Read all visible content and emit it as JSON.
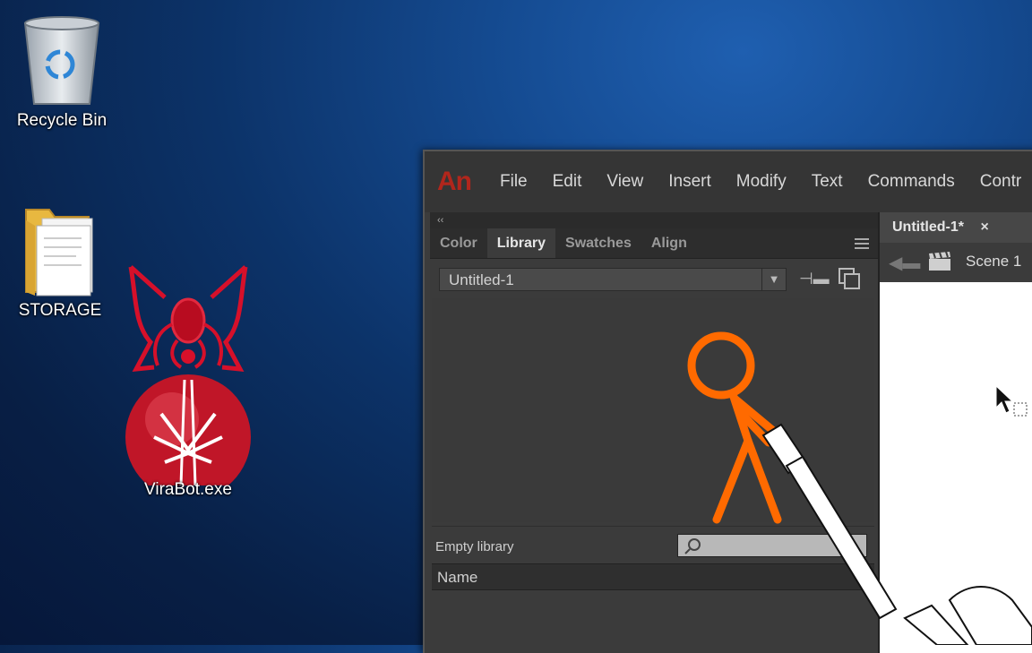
{
  "desktop": {
    "icons": [
      {
        "label": "Recycle Bin",
        "icon": "recycle-bin-icon"
      },
      {
        "label": "STORAGE",
        "icon": "folder-icon"
      },
      {
        "label": "ViraBot.exe",
        "icon": "virabot-spider-icon"
      }
    ]
  },
  "animate": {
    "logo": "An",
    "menu": [
      "File",
      "Edit",
      "View",
      "Insert",
      "Modify",
      "Text",
      "Commands",
      "Contr"
    ],
    "panel": {
      "collapse_glyph": "‹‹",
      "tabs": [
        "Color",
        "Library",
        "Swatches",
        "Align"
      ],
      "active_tab": "Library",
      "library_select": "Untitled-1",
      "status": "Empty library",
      "search_placeholder": "",
      "column_name": "Name"
    },
    "document": {
      "tab_title": "Untitled-1*",
      "close_glyph": "×",
      "scene": "Scene 1"
    }
  },
  "colors": {
    "accent_red": "#b1261c",
    "stickfigure_orange": "#ff6a00",
    "virabot_red": "#d6102a"
  }
}
